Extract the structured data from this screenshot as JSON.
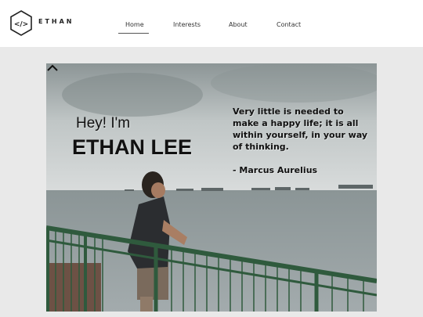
{
  "brand": {
    "name": "ETHAN",
    "logo_glyph": "</>",
    "logo_icon": "hexagon-code-icon"
  },
  "nav": {
    "items": [
      {
        "label": "Home",
        "active": true
      },
      {
        "label": "Interests"
      },
      {
        "label": "About"
      },
      {
        "label": "Contact"
      }
    ]
  },
  "hero": {
    "greeting": "Hey! I'm",
    "name": "ETHAN LEE",
    "quote_lines": [
      "Very little is needed to",
      "make a happy life; it is all",
      "within yourself, in your way",
      "of thinking."
    ],
    "quote_author": "- Marcus Aurelius",
    "scroll_up_icon": "chevron-up-icon"
  },
  "colors": {
    "page_bg": "#e9e9e9",
    "header_bg": "#ffffff",
    "railing": "#2f5a3d"
  }
}
